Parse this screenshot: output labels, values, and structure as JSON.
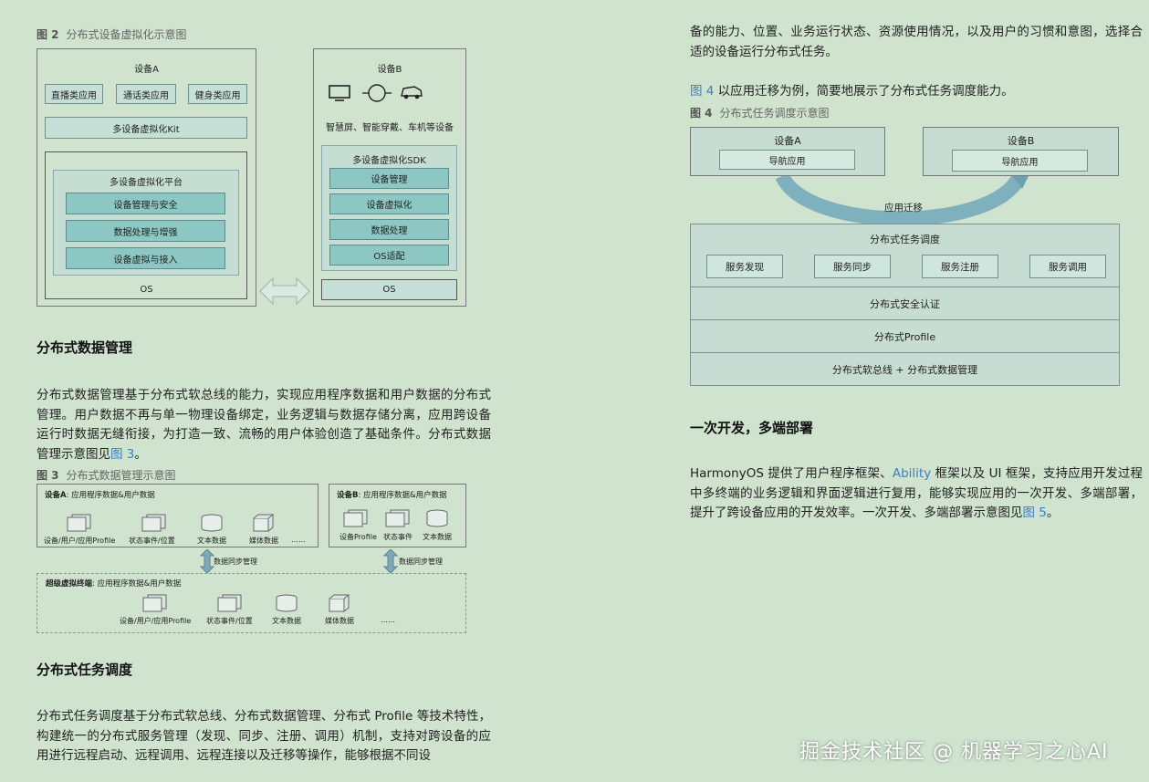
{
  "fig2": {
    "num": "图 2",
    "title": "分布式设备虚拟化示意图",
    "deviceA": {
      "title": "设备A",
      "apps": [
        "直播类应用",
        "通话类应用",
        "健身类应用"
      ],
      "kit": "多设备虚拟化Kit",
      "platform": "多设备虚拟化平台",
      "modules": [
        "设备管理与安全",
        "数据处理与增强",
        "设备虚拟与接入"
      ],
      "os": "OS"
    },
    "deviceB": {
      "title": "设备B",
      "desc": "智慧屏、智能穿戴、车机等设备",
      "sdk": "多设备虚拟化SDK",
      "modules": [
        "设备管理",
        "设备虚拟化",
        "数据处理",
        "OS适配"
      ],
      "os": "OS"
    }
  },
  "section_data": {
    "heading": "分布式数据管理",
    "para_before_link": "分布式数据管理基于分布式软总线的能力，实现应用程序数据和用户数据的分布式管理。用户数据不再与单一物理设备绑定，业务逻辑与数据存储分离，应用跨设备运行时数据无缝衔接，为打造一致、流畅的用户体验创造了基础条件。分布式数据管理示意图见",
    "link": "图 3",
    "para_after_link": "。"
  },
  "fig3": {
    "num": "图 3",
    "title": "分布式数据管理示意图",
    "deviceA": {
      "title": "设备A",
      "subtitle": ": 应用程序数据&用户数据",
      "items": [
        "设备/用户/应用Profile",
        "状态事件/位置",
        "文本数据",
        "媒体数据",
        "……"
      ]
    },
    "deviceB": {
      "title": "设备B",
      "subtitle": ": 应用程序数据&用户数据",
      "items": [
        "设备Profile",
        "状态事件",
        "文本数据"
      ]
    },
    "sync_label": "数据同步管理",
    "terminal": {
      "title": "超级虚拟终端",
      "subtitle": ": 应用程序数据&用户数据",
      "items": [
        "设备/用户/应用Profile",
        "状态事件/位置",
        "文本数据",
        "媒体数据",
        "……"
      ]
    }
  },
  "section_task": {
    "heading": "分布式任务调度",
    "para": "分布式任务调度基于分布式软总线、分布式数据管理、分布式 Profile 等技术特性，构建统一的分布式服务管理（发现、同步、注册、调用）机制，支持对跨设备的应用进行远程启动、远程调用、远程连接以及迁移等操作，能够根据不同设"
  },
  "right_col": {
    "para_cont": "备的能力、位置、业务运行状态、资源使用情况，以及用户的习惯和意图，选择合适的设备运行分布式任务。",
    "fig4_intro_link": "图 4",
    "fig4_intro_rest": " 以应用迁移为例，简要地展示了分布式任务调度能力。"
  },
  "fig4": {
    "num": "图 4",
    "title": "分布式任务调度示意图",
    "deviceA": "设备A",
    "deviceB": "设备B",
    "nav_app": "导航应用",
    "migrate": "应用迁移",
    "scheduler": "分布式任务调度",
    "services": [
      "服务发现",
      "服务同步",
      "服务注册",
      "服务调用"
    ],
    "layers": [
      "分布式安全认证",
      "分布式Profile",
      "分布式软总线 + 分布式数据管理"
    ]
  },
  "section_deploy": {
    "heading": "一次开发，多端部署",
    "para_1": "HarmonyOS 提供了用户程序框架、",
    "para_ability": "Ability",
    "para_2": " 框架以及 UI 框架，支持应用开发过程中多终端的业务逻辑和界面逻辑进行复用，能够实现应用的一次开发、多端部署，提升了跨设备应用的开发效率。一次开发、多端部署示意图见",
    "link": "图 5",
    "para_3": "。"
  },
  "watermark": "掘金技术社区 @ 机器学习之心AI"
}
